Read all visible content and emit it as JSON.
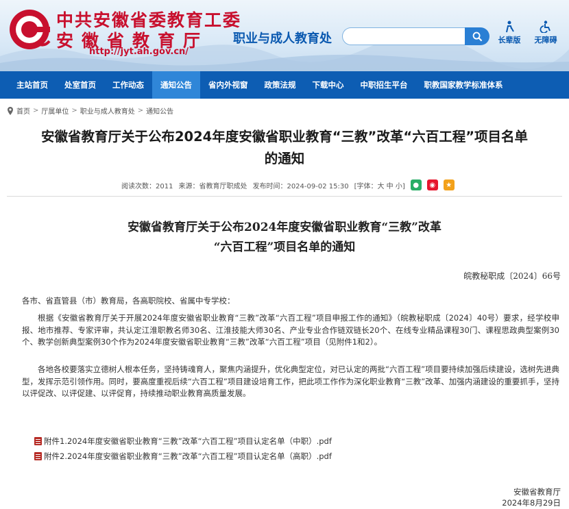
{
  "header": {
    "org_title": "中共安徽省委教育工委",
    "org_title2": "安徽省教育厅",
    "department": "职业与成人教育处",
    "url": "http://jyt.ah.gov.cn/",
    "search_placeholder": "",
    "tools": [
      {
        "label": "长辈版",
        "icon": "elder-icon"
      },
      {
        "label": "无障碍",
        "icon": "accessibility-icon"
      }
    ]
  },
  "nav": {
    "items": [
      "主站首页",
      "处室首页",
      "工作动态",
      "通知公告",
      "省内外视窗",
      "政策法规",
      "下载中心",
      "中职招生平台",
      "职教国家教学标准体系"
    ],
    "active_index": 3
  },
  "breadcrumb": [
    "首页",
    "厅属单位",
    "职业与成人教育处",
    "通知公告"
  ],
  "article": {
    "title_line1": "安徽省教育厅关于公布2024年度安徽省职业教育“三教”改革“六百工程”项目名单",
    "title_line2": "的通知",
    "views": "阅读次数：2011",
    "source": "来源：省教育厅职成处",
    "date": "发布时间：2024-09-02 15:30",
    "font_size": "[字体：大 中 小]"
  },
  "document": {
    "title_line1": "安徽省教育厅关于公布2024年度安徽省职业教育“三教”改革",
    "title_line2": "“六百工程”项目名单的通知",
    "doc_number": "皖教秘职成〔2024〕66号",
    "addressee": "各市、省直管县（市）教育局，各高职院校、省属中专学校：",
    "paragraph1": "根据《安徽省教育厅关于开展2024年度安徽省职业教育“三教”改革“六百工程”项目申报工作的通知》（皖教秘职成〔2024〕40号）要求，经学校申报、地市推荐、专家评审，共认定江淮职教名师30名、江淮技能大师30名、产业专业合作链双链长20个、在线专业精品课程30门、课程思政典型案例30个、教学创新典型案例30个作为2024年度安徽省职业教育“三教”改革“六百工程”项目（见附件1和2）。",
    "paragraph2": "各地各校要落实立德树人根本任务，坚持铸魂育人，聚焦内涵提升，优化典型定位，对已认定的两批“六百工程”项目要持续加强后续建设，选树先进典型，发挥示范引领作用。同时，要高度重视后续“六百工程”项目建设培育工作，把此项工作作为深化职业教育“三教”改革、加强内涵建设的重要抓手，坚持以评促改、以评促建、以评促育，持续推动职业教育高质量发展。",
    "attachments": [
      "附件1.2024年度安徽省职业教育“三教”改革“六百工程”项目认定名单（中职）.pdf",
      "附件2.2024年度安徽省职业教育“三教”改革“六百工程”项目认定名单（高职）.pdf"
    ],
    "signature": "安徽省教育厅",
    "sign_date": "2024年8月29日"
  },
  "colors": {
    "brand_red": "#c8102e",
    "nav_blue": "#0d5db3",
    "nav_active": "#2f86d8"
  }
}
